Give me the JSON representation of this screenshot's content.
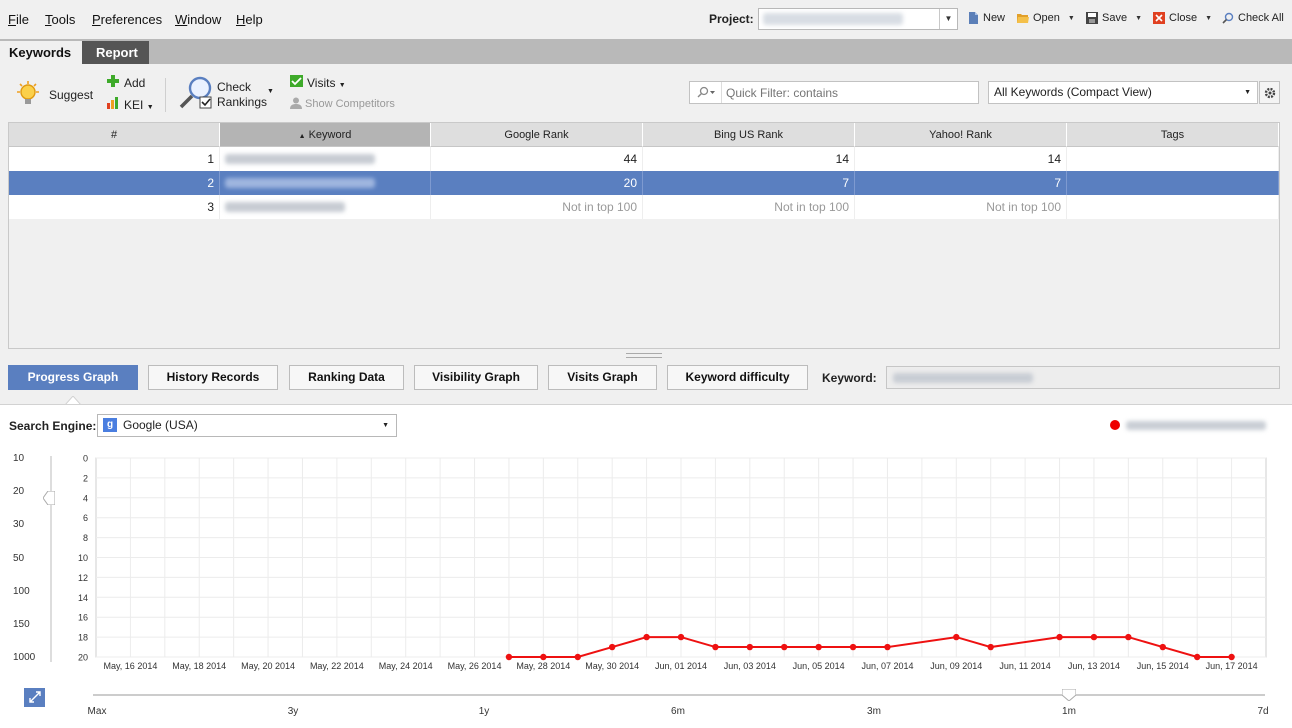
{
  "menu": [
    {
      "label": "File",
      "u": "F",
      "rest": "ile"
    },
    {
      "label": "Tools",
      "u": "T",
      "rest": "ools"
    },
    {
      "label": "Preferences",
      "u": "P",
      "rest": "references"
    },
    {
      "label": "Window",
      "u": "W",
      "rest": "indow"
    },
    {
      "label": "Help",
      "u": "H",
      "rest": "elp"
    }
  ],
  "project": {
    "label": "Project:"
  },
  "actions": {
    "new": "New",
    "open": "Open",
    "save": "Save",
    "close": "Close",
    "check_all": "Check All"
  },
  "tabs": {
    "keywords": "Keywords",
    "report": "Report"
  },
  "toolbar": {
    "suggest": "Suggest",
    "add": "Add",
    "kei": "KEI",
    "check": "Check",
    "rankings": "Rankings",
    "visits": "Visits",
    "show_competitors": "Show Competitors",
    "filter_placeholder": "Quick Filter: contains",
    "view": "All Keywords (Compact View)"
  },
  "table": {
    "columns": [
      "#",
      "Keyword",
      "Google Rank",
      "Bing US Rank",
      "Yahoo! Rank",
      "Tags"
    ],
    "sorted_column": "Keyword",
    "rows": [
      {
        "n": "1",
        "google": "44",
        "bing": "14",
        "yahoo": "14",
        "tags": ""
      },
      {
        "n": "2",
        "google": "20",
        "bing": "7",
        "yahoo": "7",
        "tags": ""
      },
      {
        "n": "3",
        "google": "Not in top 100",
        "bing": "Not in top 100",
        "yahoo": "Not in top 100",
        "tags": ""
      }
    ],
    "selected_row": 2
  },
  "bottom_tabs": [
    "Progress Graph",
    "History Records",
    "Ranking Data",
    "Visibility Graph",
    "Visits Graph",
    "Keyword difficulty"
  ],
  "keyword_label": "Keyword:",
  "search_engine": {
    "label": "Search Engine:",
    "value": "Google (USA)"
  },
  "zoom_scale": [
    "10",
    "20",
    "30",
    "50",
    "100",
    "150",
    "1000"
  ],
  "range_labels": [
    "Max",
    "3y",
    "1y",
    "6m",
    "3m",
    "1m",
    "7d"
  ],
  "chart_data": {
    "type": "line",
    "y_ticks": [
      "0",
      "2",
      "4",
      "6",
      "8",
      "10",
      "12",
      "14",
      "16",
      "18",
      "20"
    ],
    "ylim": [
      0,
      20
    ],
    "y_inverted": true,
    "x_ticks": [
      "May, 16 2014",
      "May, 18 2014",
      "May, 20 2014",
      "May, 22 2014",
      "May, 24 2014",
      "May, 26 2014",
      "May, 28 2014",
      "May, 30 2014",
      "Jun, 01 2014",
      "Jun, 03 2014",
      "Jun, 05 2014",
      "Jun, 07 2014",
      "Jun, 09 2014",
      "Jun, 11 2014",
      "Jun, 13 2014",
      "Jun, 15 2014",
      "Jun, 17 2014"
    ],
    "xlim": [
      "2014-05-15",
      "2014-06-18"
    ],
    "grid": true,
    "color": "#ee1111",
    "series": [
      {
        "x": [
          "2014-05-27",
          "2014-05-28",
          "2014-05-29",
          "2014-05-30",
          "2014-05-31",
          "2014-06-01",
          "2014-06-02",
          "2014-06-03",
          "2014-06-04",
          "2014-06-05",
          "2014-06-06",
          "2014-06-07",
          "2014-06-09",
          "2014-06-10",
          "2014-06-12",
          "2014-06-13",
          "2014-06-14",
          "2014-06-15",
          "2014-06-16",
          "2014-06-17"
        ],
        "y": [
          20,
          20,
          20,
          19,
          18,
          18,
          19,
          19,
          19,
          19,
          19,
          19,
          18,
          19,
          18,
          18,
          18,
          19,
          20,
          20
        ]
      }
    ]
  }
}
